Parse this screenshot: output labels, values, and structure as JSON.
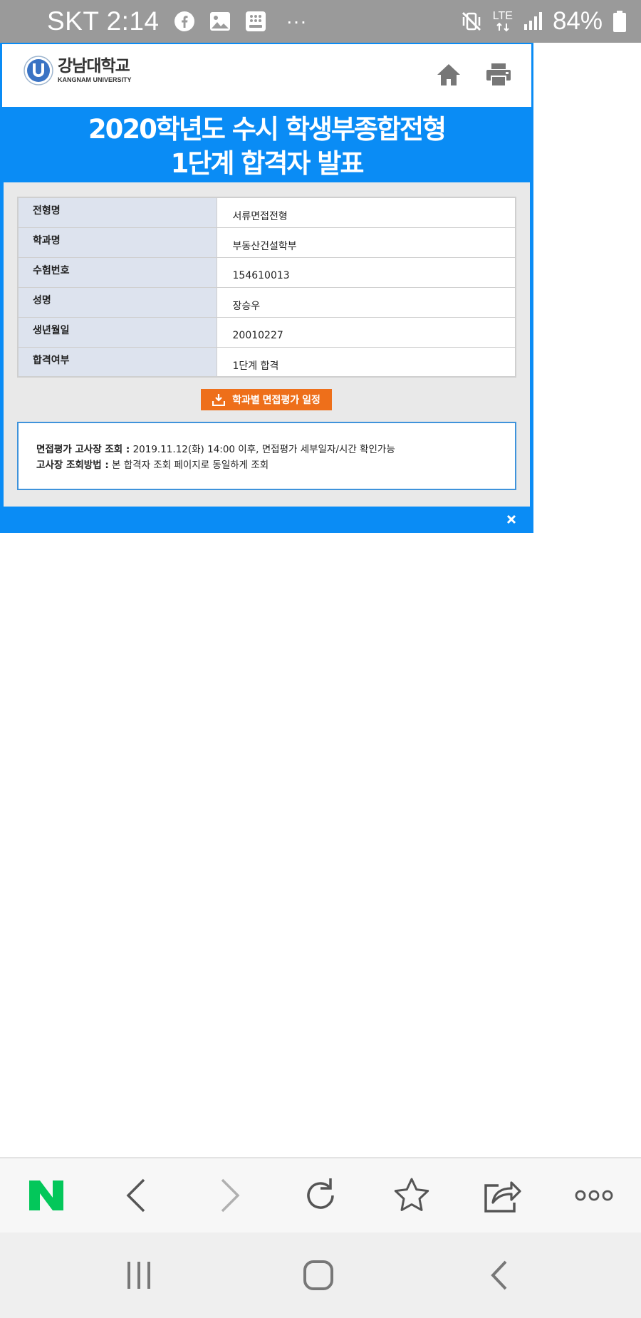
{
  "status_bar": {
    "carrier_time": "SKT 2:14",
    "more": "···",
    "network": "LTE",
    "battery": "84%"
  },
  "header": {
    "logo_ko": "강남대학교",
    "logo_en": "KANGNAM UNIVERSITY"
  },
  "title": {
    "line1": "2020학년도 수시 학생부종합전형",
    "line2": "1단계 합격자 발표"
  },
  "result_table": [
    {
      "label": "전형명",
      "value": "서류면접전형"
    },
    {
      "label": "학과명",
      "value": "부동산건설학부"
    },
    {
      "label": "수험번호",
      "value": "154610013"
    },
    {
      "label": "성명",
      "value": "장승우"
    },
    {
      "label": "생년월일",
      "value": "20010227"
    },
    {
      "label": "합격여부",
      "value": "1단계 합격"
    }
  ],
  "schedule_button": "학과별 면접평가 일정",
  "notice": {
    "line1_label": "면접평가 고사장 조회 :",
    "line1_text": " 2019.11.12(화) 14:00 이후, 면접평가 세부일자/시간 확인가능",
    "line2_label": "고사장 조회방법 :",
    "line2_text": " 본 합격자 조회 페이지로 동일하게 조회"
  },
  "colors": {
    "popup_blue": "#0a8cf5",
    "button_orange": "#ee6f1a",
    "naver_green": "#03c75a"
  }
}
